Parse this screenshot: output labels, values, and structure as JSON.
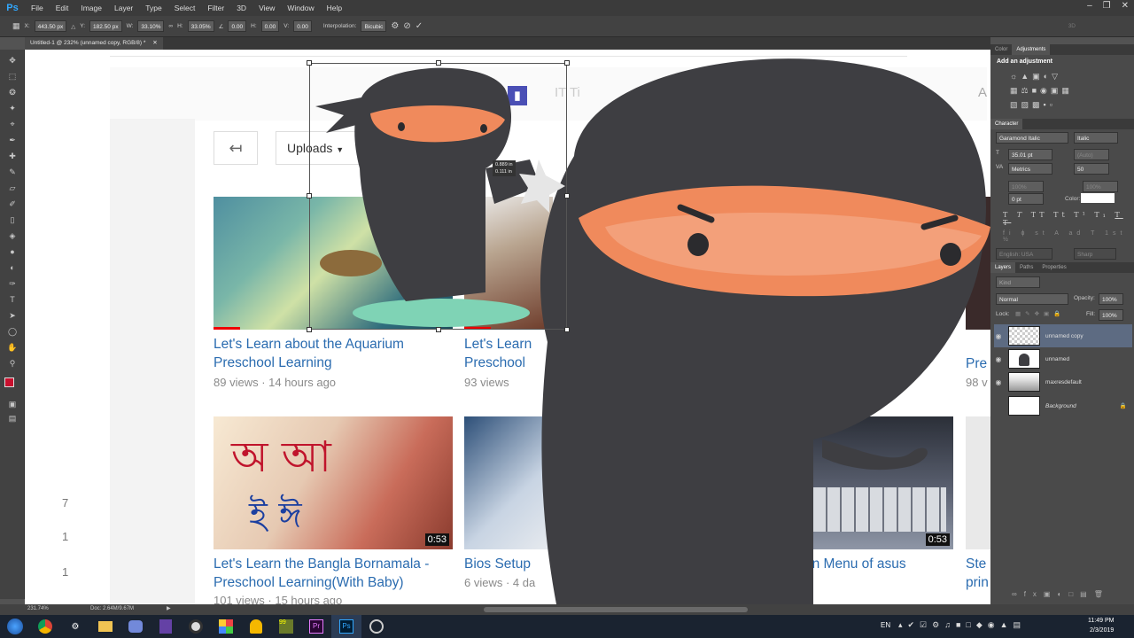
{
  "app": {
    "logo": "Ps"
  },
  "menu": [
    "File",
    "Edit",
    "Image",
    "Layer",
    "Type",
    "Select",
    "Filter",
    "3D",
    "View",
    "Window",
    "Help"
  ],
  "options": {
    "x_label": "X:",
    "x_value": "443.50 px",
    "y_label": "Y:",
    "y_value": "182.50 px",
    "w_label": "W:",
    "w_value": "33.10%",
    "h_label": "H:",
    "h_value": "33.05%",
    "angle_value": "0.00",
    "hskew_label": "H:",
    "hskew_value": "0.00",
    "vskew_label": "V:",
    "vskew_value": "0.00",
    "interp_label": "Interpolation:",
    "interp_value": "Bicubic",
    "workspace": "3D"
  },
  "document_tab": {
    "label": "Untitled-1 @ 232% (unnamed copy, RGB/8) *"
  },
  "transform_readout": {
    "line1": "0.889 in",
    "line2": "0.111 in"
  },
  "youtube": {
    "back_symbol": "↤",
    "uploads": "Uploads",
    "header_fragment": "IT Ti",
    "videos": [
      {
        "title": "Let's Learn about the Aquarium Preschool Learning",
        "meta": "89 views · 14 hours ago"
      },
      {
        "title": "Let's Learn Preschool",
        "meta": "93 views"
      },
      {
        "title": "Pre",
        "meta": "98 v"
      },
      {
        "title": "Let's Learn the Bangla Bornamala - Preschool Learning(With Baby)",
        "meta": "101 views · 15 hours ago",
        "duration": "0:53"
      },
      {
        "title": "Bios Setup",
        "meta": "6 views · 4 da"
      },
      {
        "title": "on Menu of asus",
        "meta": "",
        "duration": "0:53"
      },
      {
        "title": "Ste prin",
        "meta": ""
      }
    ],
    "side_numbers": [
      "7",
      "1",
      "1"
    ]
  },
  "panels": {
    "top_tabs": [
      "Color",
      "Adjustments"
    ],
    "add_adjustment": "Add an adjustment",
    "character_tab": "Character",
    "font_family": "Garamond Italic",
    "font_style": "Italic",
    "font_size": "35.01 pt",
    "leading": "(Auto)",
    "kerning": "Metrics",
    "tracking": "50",
    "scale_v": "100%",
    "scale_h": "100%",
    "baseline": "0 pt",
    "color_label": "Color:",
    "language": "English: USA",
    "antialias": "Sharp",
    "layer_tabs": [
      "Layers",
      "Paths",
      "Properties"
    ],
    "kind": "Kind",
    "blend_mode": "Normal",
    "opacity_label": "Opacity:",
    "opacity": "100%",
    "lock_label": "Lock:",
    "fill_label": "Fill:",
    "fill": "100%",
    "layers": [
      {
        "name": "unnamed copy",
        "selected": true
      },
      {
        "name": "unnamed",
        "selected": false
      },
      {
        "name": "maxresdefault",
        "selected": false
      },
      {
        "name": "Background",
        "selected": false
      }
    ]
  },
  "status": {
    "zoom": "231.74%",
    "doc": "Doc: 2.64M/9.67M"
  },
  "taskbar": {
    "lang": "EN",
    "time": "11:49 PM",
    "date": "2/3/2019"
  },
  "colors": {
    "foreground": "#c8102e",
    "background": "#ffffff",
    "ps_blue": "#31a8ff",
    "link_blue": "#2b6cb0"
  }
}
